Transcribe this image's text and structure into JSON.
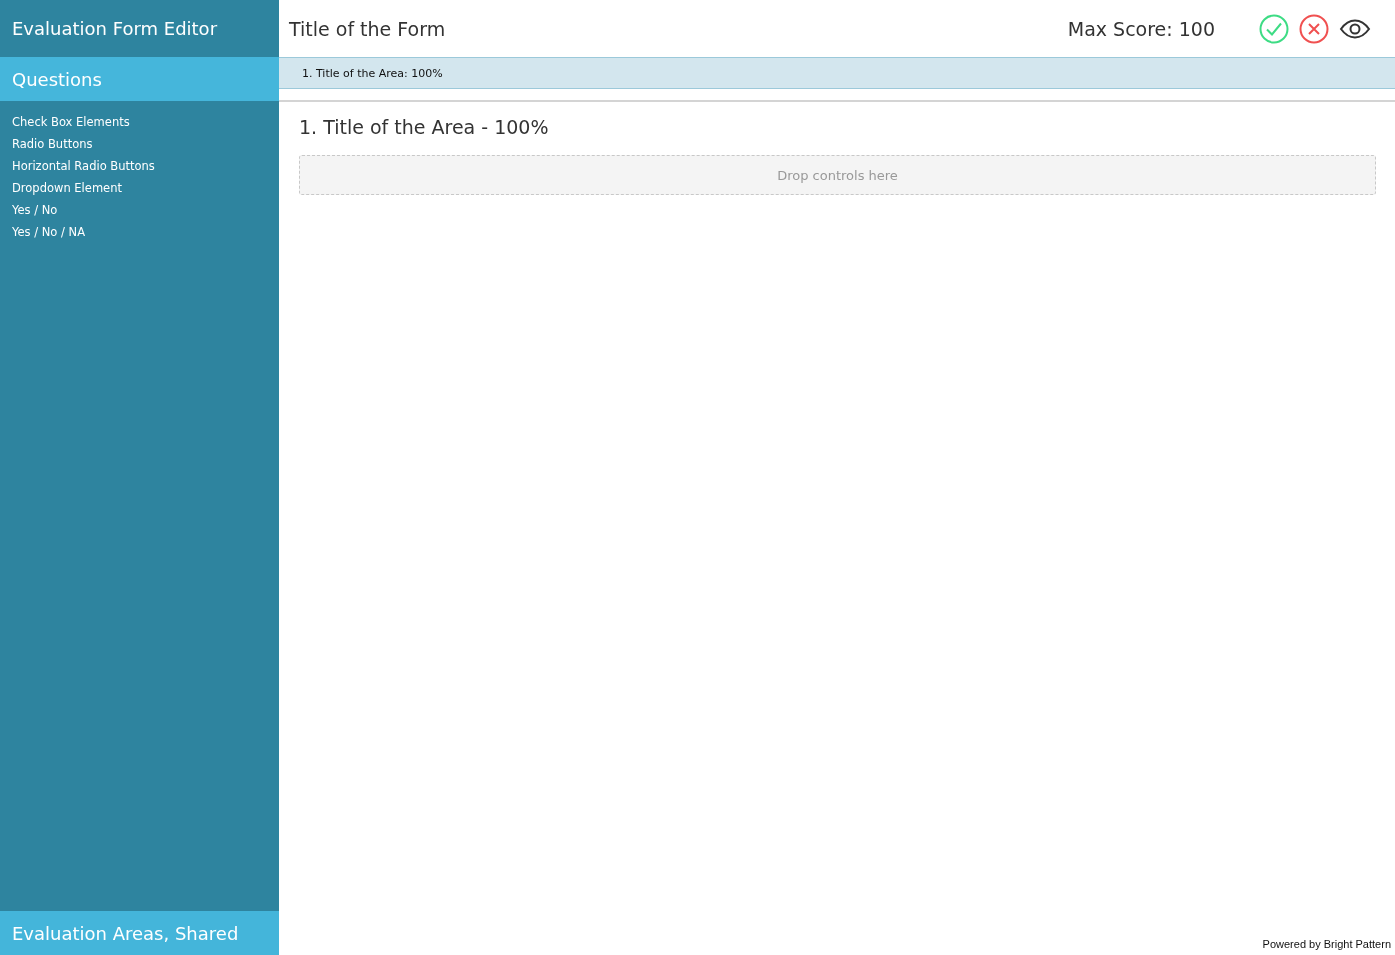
{
  "sidebar": {
    "title": "Evaluation Form Editor",
    "sections": [
      {
        "label": "Questions",
        "expanded": true,
        "items": [
          "Check Box Elements",
          "Radio Buttons",
          "Horizontal Radio Buttons",
          "Dropdown Element",
          "Yes / No",
          "Yes / No / NA"
        ]
      },
      {
        "label": "Evaluation Areas, Shared",
        "expanded": false
      }
    ]
  },
  "header": {
    "title": "Title of the Form",
    "max_score": "Max Score: 100"
  },
  "area_tabs": [
    {
      "label": "1. Title of the Area: 100%",
      "selected": true
    }
  ],
  "area": {
    "title": "1. Title of the Area - 100%",
    "drop_zone": "Drop controls here"
  },
  "footer": "Powered by Bright Pattern"
}
